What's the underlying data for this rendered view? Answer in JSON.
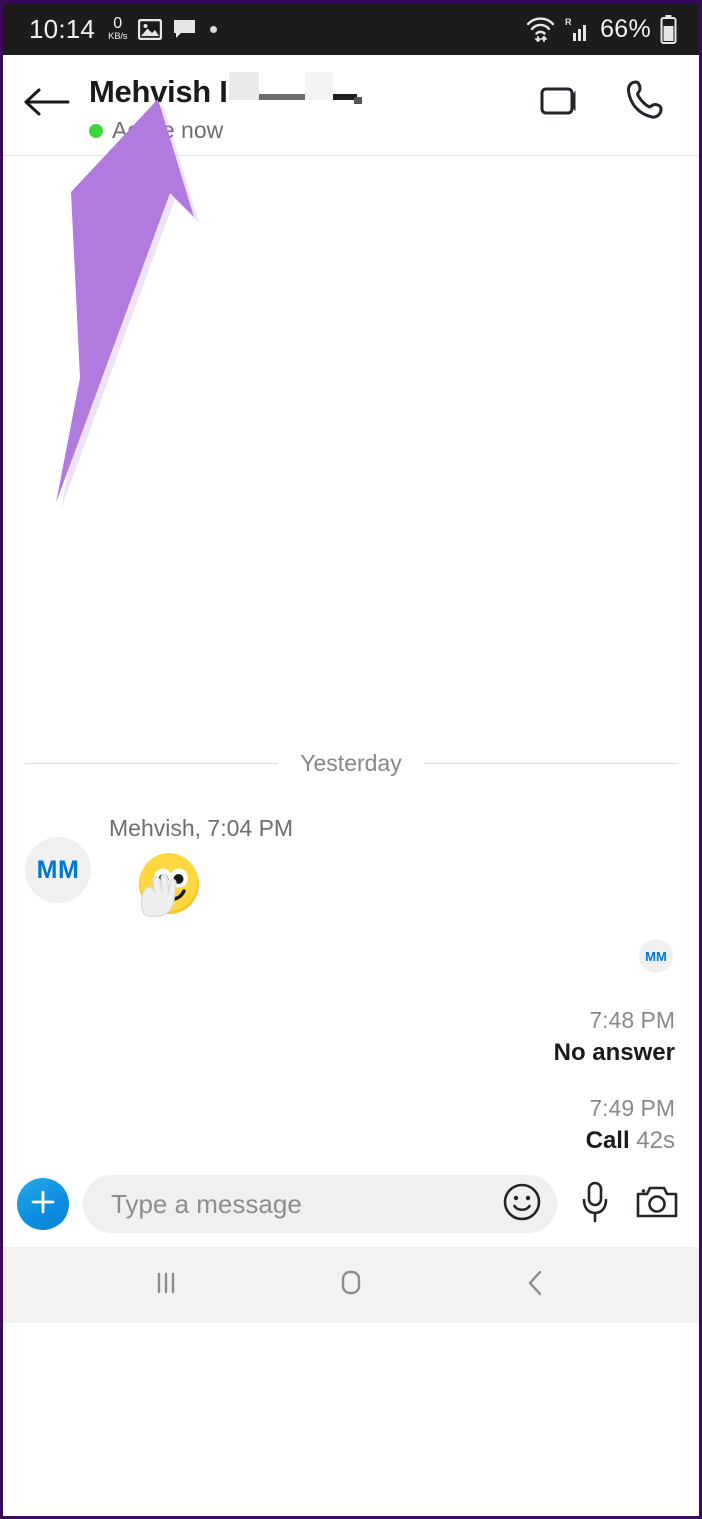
{
  "status_bar": {
    "time": "10:14",
    "net_speed_value": "0",
    "net_speed_unit": "KB/s",
    "icons": [
      "image-icon",
      "message-icon",
      "dot-icon"
    ],
    "wifi_icon": "wifi-updown-icon",
    "signal_icon": "signal-bars-icon",
    "roaming_label": "R",
    "battery_percent": "66%",
    "battery_icon": "battery-icon",
    "background": "#1c1c1c"
  },
  "header": {
    "back_icon": "back-arrow-icon",
    "contact_name": "Mehvish I",
    "name_redacted": true,
    "presence_text": "Active now",
    "presence_color": "#3ad63a",
    "video_call_icon": "video-camera-icon",
    "voice_call_icon": "phone-handset-icon"
  },
  "conversation": {
    "day_divider": "Yesterday",
    "messages": [
      {
        "avatar_initials": "MM",
        "meta": "Mehvish, 7:04 PM",
        "content_type": "emoji",
        "emoji_name": "waving-emoji"
      }
    ],
    "own_avatar_initials": "MM",
    "call_entries": [
      {
        "time": "7:48 PM",
        "status": "No answer",
        "duration": ""
      },
      {
        "time": "7:49 PM",
        "status": "Call",
        "duration": "42s"
      }
    ]
  },
  "composer": {
    "add_icon": "plus-icon",
    "add_color": "#0b8de0",
    "placeholder": "Type a message",
    "emoji_icon": "smiley-icon",
    "mic_icon": "microphone-icon",
    "camera_icon": "camera-icon"
  },
  "nav_bar": {
    "recents_icon": "recents-icon",
    "home_icon": "home-icon",
    "back_icon": "back-chevron-icon"
  },
  "annotation": {
    "arrow_color": "#b07ade",
    "points_to": "contact-name"
  }
}
